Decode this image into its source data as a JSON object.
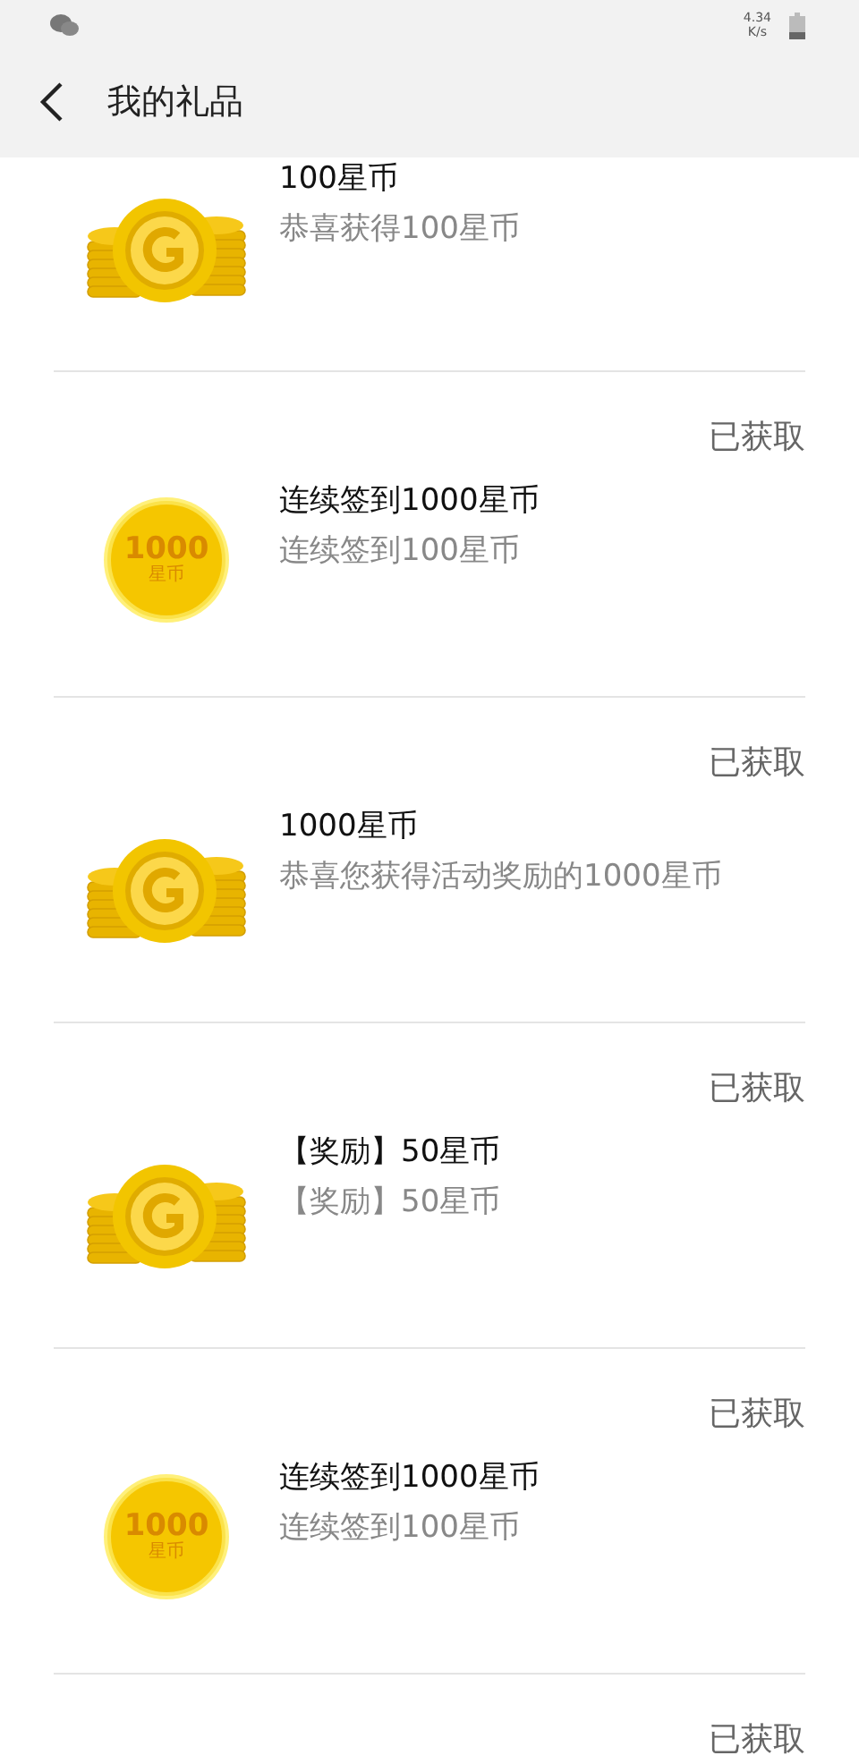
{
  "status_bar": {
    "speed": "4.34",
    "speed_unit": "K/s"
  },
  "header": {
    "title": "我的礼品"
  },
  "gifts": [
    {
      "kind": "stack",
      "title": "100星币",
      "subtitle": "恭喜获得100星币"
    },
    {
      "kind": "badge",
      "status": "已获取",
      "badge_value": "1000",
      "badge_unit": "星币",
      "title": "连续签到1000星币",
      "subtitle": "连续签到100星币"
    },
    {
      "kind": "stack",
      "status": "已获取",
      "title": "1000星币",
      "subtitle": "恭喜您获得活动奖励的1000星币"
    },
    {
      "kind": "stack",
      "status": "已获取",
      "title": "【奖励】50星币",
      "subtitle": "【奖励】50星币"
    },
    {
      "kind": "badge",
      "status": "已获取",
      "badge_value": "1000",
      "badge_unit": "星币",
      "title": "连续签到1000星币",
      "subtitle": "连续签到100星币"
    },
    {
      "kind": "none",
      "status": "已获取"
    }
  ]
}
